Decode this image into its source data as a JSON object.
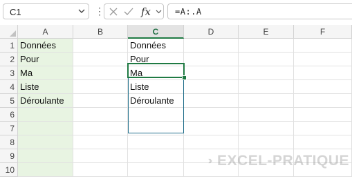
{
  "formula_bar": {
    "name_box": "C1",
    "fx_label": "fx",
    "formula": "=A:.A"
  },
  "columns": [
    "A",
    "B",
    "C",
    "D",
    "E",
    "F"
  ],
  "active_column": "C",
  "rows": [
    "1",
    "2",
    "3",
    "4",
    "5",
    "6",
    "7",
    "8",
    "9",
    "10"
  ],
  "cells": {
    "A": [
      "Données",
      "Pour",
      "Ma",
      "Liste",
      "Déroulante"
    ],
    "C": [
      "Données",
      "Pour",
      "Ma",
      "Liste",
      "Déroulante"
    ]
  },
  "active_cell": "C1",
  "colors": {
    "accent": "#1f7a43",
    "column_a_fill": "#e8f4e2",
    "spill_border": "#1f6e8a"
  },
  "watermark": "EXCEL-PRATIQUE"
}
